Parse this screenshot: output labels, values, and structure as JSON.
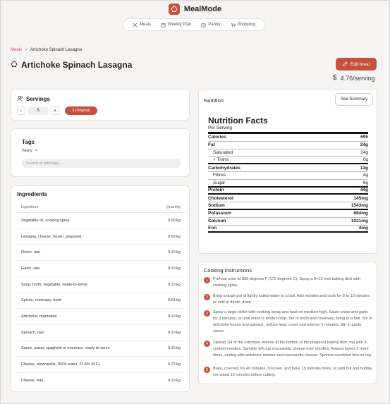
{
  "brand": {
    "name": "MealMode"
  },
  "nav": [
    {
      "label": "Meals",
      "icon": "utensils-icon"
    },
    {
      "label": "Weekly Plan",
      "icon": "calendar-icon"
    },
    {
      "label": "Pantry",
      "icon": "pantry-icon"
    },
    {
      "label": "Shopping",
      "icon": "cart-icon"
    }
  ],
  "breadcrumb": {
    "parent": "Meals",
    "current": "Artichoke Spinach Lasagna"
  },
  "recipe": {
    "title": "Artichoke Spinach Lasagna",
    "edit_label": "Edit meal",
    "price_symbol": "$",
    "price": "4.76/serving"
  },
  "servings": {
    "title": "Servings",
    "minus": "-",
    "value": "5",
    "plus": "+",
    "original_label": "5 (Original)"
  },
  "tags": {
    "title": "Tags",
    "items": [
      {
        "label": "Hearty",
        "remove": "×"
      }
    ],
    "placeholder": "Search or add tags..."
  },
  "ingredients": {
    "title": "Ingredients",
    "columns": [
      "Ingredient",
      "Quantity"
    ],
    "rows": [
      {
        "name": "Vegetable oil, cooking spray",
        "qty": "0.00 kg"
      },
      {
        "name": "Lasagna, cheese, frozen, prepared",
        "qty": "0.50 kg"
      },
      {
        "name": "Onion, raw",
        "qty": "0.10 kg"
      },
      {
        "name": "Garlic, raw",
        "qty": "0.10 kg"
      },
      {
        "name": "Soup, broth, vegetable, ready-to-serve",
        "qty": "0.10 kg"
      },
      {
        "name": "Spices, rosemary, fresh",
        "qty": "0.01 kg"
      },
      {
        "name": "Artichoke, marinated",
        "qty": "0.10 kg"
      },
      {
        "name": "Spinach, raw",
        "qty": "0.10 kg"
      },
      {
        "name": "Sauce, pasta, spaghetti or marinara, ready-to-serve",
        "qty": "0.10 kg"
      },
      {
        "name": "Cheese, mozzarella, (52% water, 22.5% M.F.)",
        "qty": "0.72 kg"
      },
      {
        "name": "Cheese, feta",
        "qty": "0.10 kg"
      }
    ]
  },
  "nutrition": {
    "label": "Nutrition",
    "summary_label": "See Summary",
    "facts_title": "Nutrition Facts",
    "per": "Per Serving",
    "rows": [
      {
        "label": "Calories",
        "value": "695",
        "bold": true
      },
      {
        "label": "Fat",
        "value": "24g",
        "bold": true
      },
      {
        "label": "Saturated",
        "value": "24g",
        "indent": true
      },
      {
        "label": "+ Trans",
        "value": "0g",
        "indent": true,
        "thick": true
      },
      {
        "label": "Carbohydrates",
        "value": "13g",
        "bold": true
      },
      {
        "label": "Fibres",
        "value": "4g",
        "indent": true
      },
      {
        "label": "Sugar",
        "value": "9g",
        "indent": true,
        "thick": true
      },
      {
        "label": "Protein",
        "value": "44g",
        "bold": true,
        "thick": true
      },
      {
        "label": "Cholesterol",
        "value": "145mg",
        "bold": true
      },
      {
        "label": "Sodium",
        "value": "1543mg",
        "bold": true,
        "thick": true
      },
      {
        "label": "Potassium",
        "value": "684mg",
        "bold": true
      },
      {
        "label": "Calcium",
        "value": "1021mg",
        "bold": true
      },
      {
        "label": "Iron",
        "value": "4mg",
        "bold": true,
        "thick": true
      }
    ]
  },
  "cooking": {
    "title": "Cooking Instructions",
    "steps": [
      {
        "num": "1",
        "text": "Preheat oven to 350 degrees F (175 degrees C). Spray a 9×13 inch baking dish with cooking spray."
      },
      {
        "num": "2",
        "text": "Bring a large pot of lightly salted water to a boil. Add noodles and cook for 8 to 10 minutes or until al dente; drain."
      },
      {
        "num": "3",
        "text": "Spray a large skillet with cooking spray and heat on medium-high. Saute onion and garlic for 3 minutes, or until onion is tender-crisp. Stir in broth and rosemary; bring to a boil. Stir in artichoke hearts and spinach; reduce heat, cover and simmer 5 minutes. Stir in pasta sauce."
      },
      {
        "num": "4",
        "text": "Spread 1/4 of the artichoke mixture in the bottom of the prepared baking dish; top with 3 cooked noodles. Sprinkle 3/4 cup mozzarella cheese over noodles. Repeat layers 2 more times, ending with artichoke mixture and mozzarella cheese. Sprinkle crumbled feta on top."
      },
      {
        "num": "5",
        "text": "Bake, covered, for 40 minutes. Uncover, and bake 15 minutes more, or until hot and bubbly. Let stand 10 minutes before cutting."
      }
    ]
  },
  "colors": {
    "accent": "#c8503e",
    "background": "#f5f4f2",
    "card": "#ffffff"
  }
}
